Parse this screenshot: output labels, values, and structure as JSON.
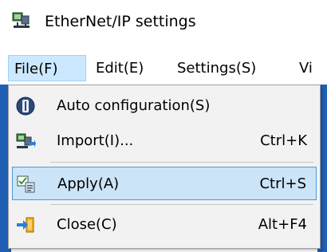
{
  "window": {
    "title": "EtherNet/IP settings",
    "icon": "network-computer-icon"
  },
  "menubar": {
    "items": [
      {
        "label": "File(F)",
        "state": "open"
      },
      {
        "label": "Edit(E)"
      },
      {
        "label": "Settings(S)"
      },
      {
        "label": "Vi"
      }
    ]
  },
  "file_menu": {
    "items": [
      {
        "label": "Auto configuration(S)",
        "shortcut": "",
        "icon": "auto-configuration-icon"
      },
      {
        "label": "Import(I)...",
        "shortcut": "Ctrl+K",
        "icon": "import-icon"
      },
      {
        "label": "Apply(A)",
        "shortcut": "Ctrl+S",
        "icon": "apply-icon",
        "highlighted": true
      },
      {
        "label": "Close(C)",
        "shortcut": "Alt+F4",
        "icon": "close-arrow-icon"
      }
    ]
  },
  "colors": {
    "highlight": "#cce4f7",
    "highlight_border": "#4a9be0",
    "menu_background": "#f2f2f2",
    "background_window": "#1f5fb5"
  }
}
